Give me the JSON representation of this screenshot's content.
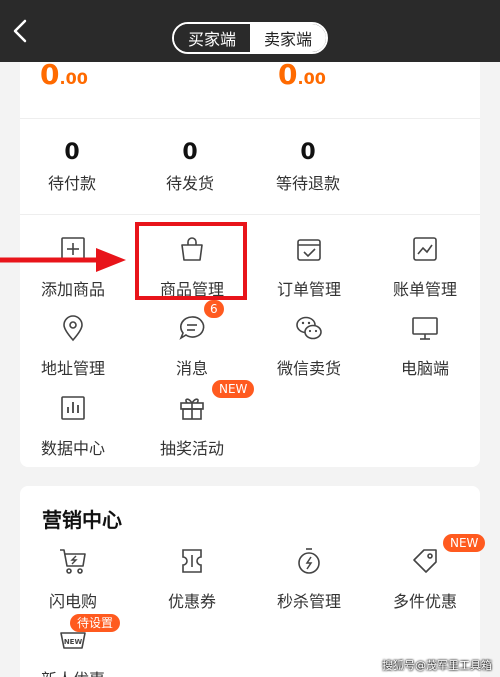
{
  "header": {
    "back_icon": "chevron-left-icon",
    "tabs": [
      {
        "label": "买家端",
        "active": false
      },
      {
        "label": "卖家端",
        "active": true
      }
    ]
  },
  "summary": {
    "amounts": [
      {
        "integer": "0",
        "decimals": ".00"
      },
      {
        "integer": "0",
        "decimals": ".00"
      }
    ],
    "counts": [
      {
        "value": "0",
        "label": "待付款"
      },
      {
        "value": "0",
        "label": "待发货"
      },
      {
        "value": "0",
        "label": "等待退款"
      }
    ]
  },
  "tools": [
    {
      "label": "添加商品",
      "icon": "add-product-icon"
    },
    {
      "label": "商品管理",
      "icon": "shopping-bag-icon"
    },
    {
      "label": "订单管理",
      "icon": "order-icon"
    },
    {
      "label": "账单管理",
      "icon": "bill-chart-icon"
    },
    {
      "label": "地址管理",
      "icon": "location-pin-icon"
    },
    {
      "label": "消息",
      "icon": "message-icon",
      "badge": "6"
    },
    {
      "label": "微信卖货",
      "icon": "wechat-icon"
    },
    {
      "label": "电脑端",
      "icon": "monitor-icon"
    },
    {
      "label": "数据中心",
      "icon": "bar-chart-icon"
    },
    {
      "label": "抽奖活动",
      "icon": "gift-icon",
      "badge": "NEW"
    }
  ],
  "marketing": {
    "title": "营销中心",
    "items": [
      {
        "label": "闪电购",
        "icon": "lightning-cart-icon"
      },
      {
        "label": "优惠券",
        "icon": "coupon-icon"
      },
      {
        "label": "秒杀管理",
        "icon": "stopwatch-icon"
      },
      {
        "label": "多件优惠",
        "icon": "tag-icon",
        "badge": "NEW"
      },
      {
        "label": "新人优惠",
        "icon": "new-basket-icon",
        "badge": "待设置"
      }
    ]
  },
  "watermark": "搜狐号@茂军里工具箱",
  "colors": {
    "accent": "#ff6a00",
    "badge": "#ff5a1f",
    "highlight": "#e8141a",
    "header": "#2a2a2a"
  }
}
